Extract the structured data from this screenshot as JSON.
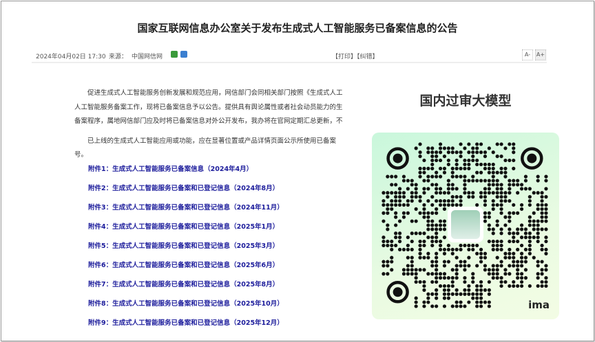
{
  "article": {
    "title": "国家互联网信息办公室关于发布生成式人工智能服务已备案信息的公告",
    "date": "2024年04月02日 17:30",
    "source_label": "来源：",
    "source": "中国网信网",
    "actions": "【打印】【纠错】",
    "font_smaller": "A-",
    "font_larger": "A+",
    "paragraphs": [
      "　　促进生成式人工智能服务创新发展和规范应用，网信部门会同相关部门按照《生成式人工",
      "人工智能服务备案工作，现将已备案信息予以公告。提供具有舆论属性或者社会动员能力的生",
      "备案程序，属地网信部门应及时将已备案信息对外公开发布，我办将在官网定期汇总更新，不",
      "　　已上线的生成式人工智能应用或功能，应在显著位置或产品详情页面公示所使用已备案",
      "号。"
    ],
    "attachments": [
      "附件1：生成式人工智能服务已备案信息（2024年4月）",
      "附件2：生成式人工智能服务已备案和已登记信息（2024年8月）",
      "附件3：生成式人工智能服务已备案和已登记信息（2024年11月）",
      "附件4：生成式人工智能服务已备案和已登记信息（2025年1月）",
      "附件5：生成式人工智能服务已备案和已登记信息（2025年3月）",
      "附件6：生成式人工智能服务已备案和已登记信息（2025年6月）",
      "附件7：生成式人工智能服务已备案和已登记信息（2025年8月）",
      "附件8：生成式人工智能服务已备案和已登记信息（2025年10月）",
      "附件9：生成式人工智能服务已备案和已登记信息（2025年12月）"
    ]
  },
  "panel": {
    "title": "国内过审大模型",
    "brand": "ima"
  },
  "colors": {
    "link": "#1d1d9c"
  }
}
